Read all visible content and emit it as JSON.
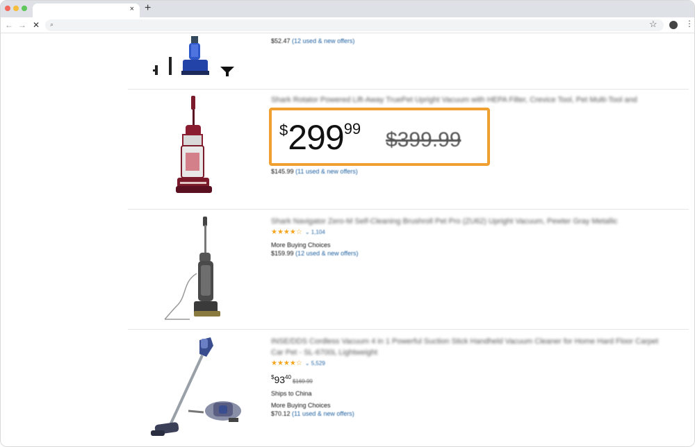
{
  "browser": {
    "tab_close": "×",
    "new_tab": "+",
    "back": "←",
    "forward": "→",
    "stop": "✕",
    "search_glyph": "⌕",
    "star": "☆",
    "menu": "⋮",
    "icons": [
      "back-arrow-icon",
      "forward-arrow-icon",
      "stop-loading-icon",
      "search-icon",
      "bookmark-star-icon",
      "profile-icon",
      "kebab-menu-icon"
    ]
  },
  "products": [
    {
      "offer_price": "$52.47",
      "offers": "(12 used & new offers)"
    },
    {
      "title": "Shark Rotator Powered Lift-Away TruePet Upright Vacuum with HEPA Filter, Crevice Tool, Pet Multi-Tool and",
      "price": {
        "currency": "$",
        "whole": "299",
        "fraction": "99",
        "was": "$399.99"
      },
      "offer_price": "$145.99",
      "offers": "(11 used & new offers)"
    },
    {
      "title": "Shark Navigator Zero-M Self-Cleaning Brushroll Pet Pro (ZU62) Upright Vacuum, Pewter Gray Metallic",
      "stars": "★★★★☆",
      "rating_count": "⌄ 1,104",
      "buying_choices": "More Buying Choices",
      "offer_price": "$159.99",
      "offers": "(12 used & new offers)"
    },
    {
      "title": "INSE/DDS Cordless Vacuum 4 in 1 Powerful Suction Stick Handheld Vacuum Cleaner for Home Hard Floor Carpet",
      "title_line2": "Car Pet - SL-6700L Lightweight",
      "stars": "★★★★☆",
      "rating_count": "⌄ 5,529",
      "price": {
        "currency": "$",
        "whole": "93",
        "fraction": "40",
        "was": "$169.99"
      },
      "ships": "Ships to China",
      "buying_choices": "More Buying Choices",
      "offer_price": "$70.12",
      "offers": "(11 used & new offers)"
    }
  ],
  "colors": {
    "highlight": "#f0a030",
    "link": "#2162a1",
    "star": "#f4a51c"
  }
}
